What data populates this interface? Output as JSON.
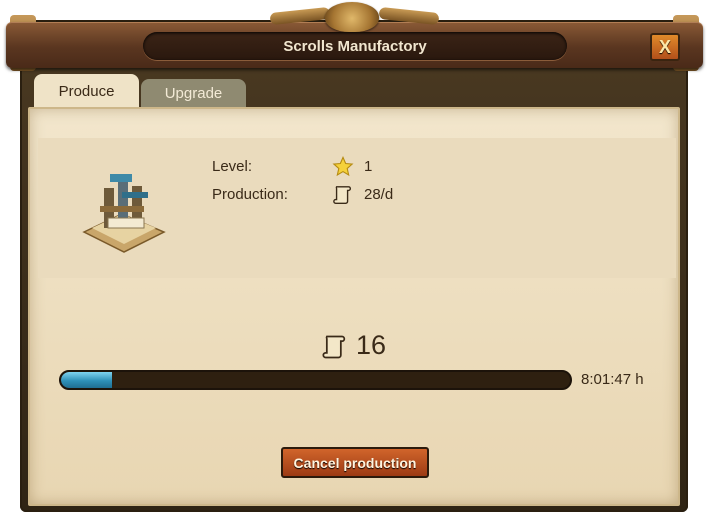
{
  "window": {
    "title": "Scrolls Manufactory",
    "close_label": "X"
  },
  "tabs": [
    {
      "label": "Produce",
      "active": true
    },
    {
      "label": "Upgrade",
      "active": false
    }
  ],
  "info": {
    "level_label": "Level:",
    "level_value": "1",
    "production_label": "Production:",
    "production_value": "28/d"
  },
  "progress": {
    "amount": "16",
    "percent": 10,
    "remaining": "8:01:47 h",
    "icon": "scroll-icon"
  },
  "cancel_label": "Cancel production",
  "colors": {
    "accent_button": "#b8481e",
    "progress_fill": "#2e90b8",
    "panel_bg": "#f2e6cc"
  }
}
